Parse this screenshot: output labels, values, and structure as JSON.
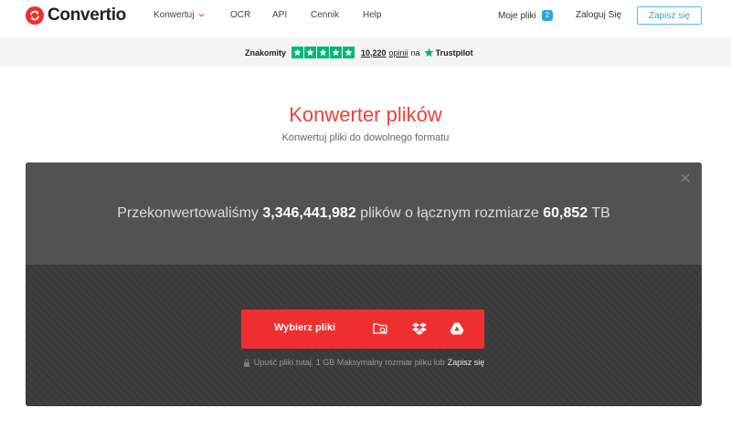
{
  "header": {
    "brand": "Convertio",
    "nav": {
      "konwertuj": "Konwertuj",
      "ocr": "OCR",
      "api": "API",
      "cennik": "Cennik",
      "help": "Help"
    },
    "my_files_label": "Moje pliki",
    "my_files_count": "2",
    "login_label": "Zaloguj Się",
    "signup_label": "Zapisz się"
  },
  "trustbar": {
    "rating_label": "Znakomity",
    "stars": 5,
    "review_count": "10,220",
    "reviews_word": "opinii",
    "on_word": "na",
    "platform": "Trustpilot"
  },
  "hero": {
    "title": "Konwerter plików",
    "subtitle": "Konwertuj pliki do dowolnego formatu"
  },
  "converter": {
    "stats_prefix": "Przekonwertowaliśmy",
    "files_count": "3,346,441,982",
    "stats_middle": "plików o łącznym rozmiarze",
    "total_size": "60,852",
    "stats_unit": "TB",
    "choose_button": "Wybierz pliki",
    "drop_note": "Upuść pliki tutaj. 1 GB Maksymalny rozmiar pliku lub",
    "drop_note_link": "Zapisz się"
  },
  "colors": {
    "brand_red": "#ef2f2f",
    "title_red": "#ef4136",
    "accent_blue": "#2aa6e0",
    "trustpilot_green": "#00b67a"
  },
  "icons": [
    "convertio-logo-icon",
    "chevron-down-icon",
    "trustpilot-star-icon",
    "close-icon",
    "folder-search-icon",
    "dropbox-icon",
    "google-drive-icon",
    "lock-icon"
  ]
}
